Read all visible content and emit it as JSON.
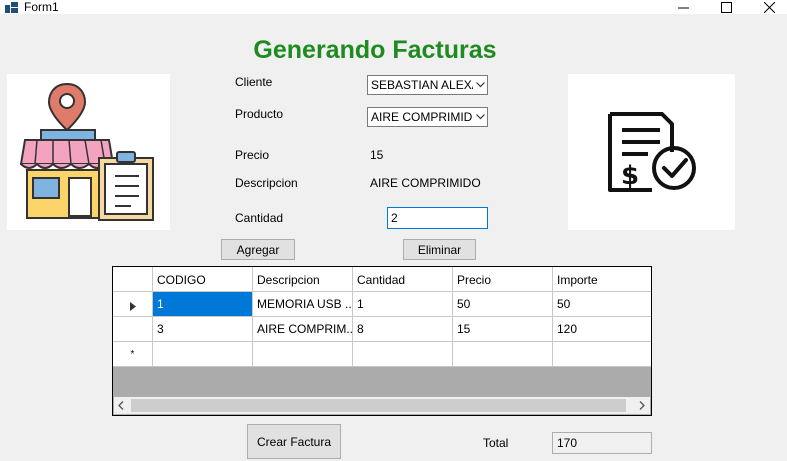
{
  "window": {
    "title": "Form1",
    "minimize_label": "—",
    "maximize_label": "☐",
    "close_label": "✕"
  },
  "heading": "Generando Facturas",
  "form": {
    "cliente_label": "Cliente",
    "cliente_value": "SEBASTIAN ALEXA",
    "producto_label": "Producto",
    "producto_value": "AIRE COMPRIMIDO",
    "precio_label": "Precio",
    "precio_value": "15",
    "descripcion_label": "Descripcion",
    "descripcion_value": "AIRE COMPRIMIDO",
    "cantidad_label": "Cantidad",
    "cantidad_value": "2"
  },
  "buttons": {
    "agregar": "Agregar",
    "eliminar": "Eliminar",
    "crear_factura": "Crear Factura"
  },
  "grid": {
    "columns": [
      "CODIGO",
      "Descripcion",
      "Cantidad",
      "Precio",
      "Importe"
    ],
    "rows": [
      [
        "1",
        "MEMORIA USB ...",
        "1",
        "50",
        "50"
      ],
      [
        "3",
        "AIRE COMPRIM...",
        "8",
        "15",
        "120"
      ]
    ],
    "new_row_marker": "*"
  },
  "total": {
    "label": "Total",
    "value": "170"
  },
  "icons": {
    "app": "form-icon",
    "store": "store-illustration-icon",
    "invoice": "invoice-check-icon"
  },
  "colors": {
    "heading": "#1f8a1f",
    "selection": "#0078d7",
    "grid_empty": "#ababab"
  }
}
